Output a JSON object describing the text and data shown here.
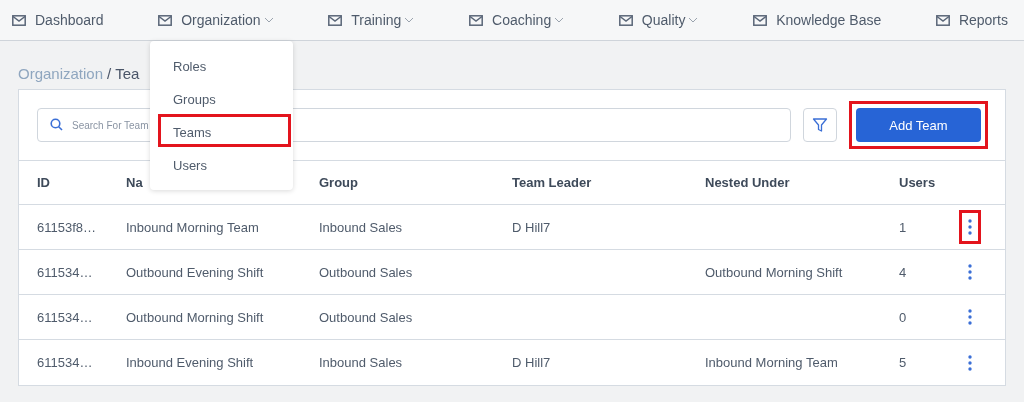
{
  "nav": [
    {
      "label": "Dashboard",
      "has_caret": false
    },
    {
      "label": "Organization",
      "has_caret": true
    },
    {
      "label": "Training",
      "has_caret": true
    },
    {
      "label": "Coaching",
      "has_caret": true
    },
    {
      "label": "Quality",
      "has_caret": true
    },
    {
      "label": "Knowledge Base",
      "has_caret": false
    },
    {
      "label": "Reports",
      "has_caret": false
    }
  ],
  "dropdown": [
    {
      "label": "Roles",
      "highlighted": false
    },
    {
      "label": "Groups",
      "highlighted": false
    },
    {
      "label": "Teams",
      "highlighted": true
    },
    {
      "label": "Users",
      "highlighted": false
    }
  ],
  "breadcrumb": {
    "parent": "Organization",
    "separator": "/",
    "current": "Tea"
  },
  "search": {
    "placeholder": "Search For Team"
  },
  "add_button": {
    "label": "Add Team",
    "highlighted": true
  },
  "table": {
    "columns": [
      "ID",
      "Na",
      "Group",
      "Team Leader",
      "Nested Under",
      "Users"
    ],
    "rows": [
      {
        "cells": [
          "61153f8…",
          "Inbound Morning Team",
          "Inbound Sales",
          "D Hill7",
          "",
          "1"
        ],
        "menu_highlighted": true
      },
      {
        "cells": [
          "611534…",
          "Outbound Evening Shift",
          "Outbound Sales",
          "",
          "Outbound Morning Shift",
          "4"
        ],
        "menu_highlighted": false
      },
      {
        "cells": [
          "611534…",
          "Outbound Morning Shift",
          "Outbound Sales",
          "",
          "",
          "0"
        ],
        "menu_highlighted": false
      },
      {
        "cells": [
          "611534…",
          "Inbound Evening Shift",
          "Inbound Sales",
          "D Hill7",
          "Inbound Morning Team",
          "5"
        ],
        "menu_highlighted": false
      }
    ]
  }
}
